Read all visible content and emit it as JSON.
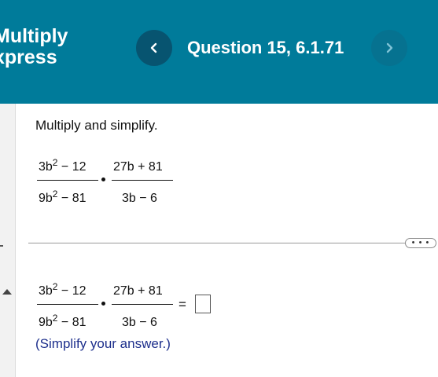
{
  "header": {
    "app_title": "Multiply\nxpress",
    "question_title": "Question 15, 6.1.71",
    "prev_label": "‹",
    "next_label": "›"
  },
  "colors": {
    "header_bg": "#007b9a",
    "prev_button_bg": "#075470",
    "next_button_bg": "#067290",
    "hint_text": "#1d2f8c"
  },
  "question": {
    "prompt": "Multiply and simplify.",
    "fraction1": {
      "num_base": "3b",
      "num_exp": "2",
      "num_rest": " − 12",
      "den_base": "9b",
      "den_exp": "2",
      "den_rest": " − 81"
    },
    "fraction2": {
      "num": "27b + 81",
      "den": "3b − 6"
    },
    "operator": "•"
  },
  "answer": {
    "fraction1": {
      "num_base": "3b",
      "num_exp": "2",
      "num_rest": " − 12",
      "den_base": "9b",
      "den_exp": "2",
      "den_rest": " − 81"
    },
    "fraction2": {
      "num": "27b + 81",
      "den": "3b − 6"
    },
    "equals": "=",
    "input_value": "",
    "hint": "(Simplify your answer.)"
  },
  "more_button_label": "• • •"
}
